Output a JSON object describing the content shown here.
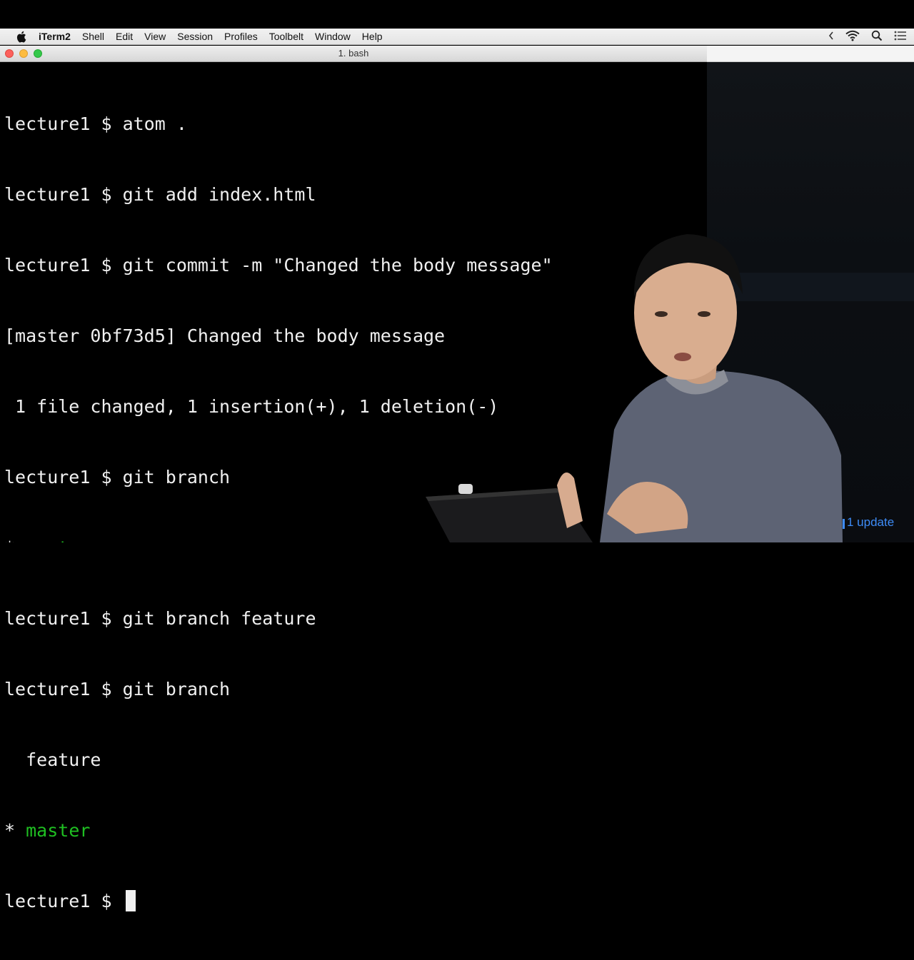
{
  "menubar": {
    "app": "iTerm2",
    "items": [
      "Shell",
      "Edit",
      "View",
      "Session",
      "Profiles",
      "Toolbelt",
      "Window",
      "Help"
    ]
  },
  "window": {
    "tab_title": "1. bash"
  },
  "terminal": {
    "lines": [
      {
        "prompt": "lecture1 $ ",
        "text": "atom ."
      },
      {
        "prompt": "lecture1 $ ",
        "text": "git add index.html"
      },
      {
        "prompt": "lecture1 $ ",
        "text": "git commit -m \"Changed the body message\""
      },
      {
        "prompt": "",
        "text": "[master 0bf73d5] Changed the body message"
      },
      {
        "prompt": "",
        "text": " 1 file changed, 1 insertion(+), 1 deletion(-)"
      },
      {
        "prompt": "lecture1 $ ",
        "text": "git branch"
      },
      {
        "marker": "* ",
        "branch": "master"
      },
      {
        "prompt": "lecture1 $ ",
        "text": "git branch feature"
      },
      {
        "prompt": "lecture1 $ ",
        "text": "git branch"
      },
      {
        "prompt": "",
        "text": "  feature"
      },
      {
        "marker": "* ",
        "branch": "master"
      },
      {
        "prompt": "lecture1 $ ",
        "text": ""
      }
    ],
    "colors": {
      "background": "#000000",
      "foreground": "#f0f0f0",
      "current_branch": "#1fbf22"
    }
  },
  "notification": {
    "label": "1 update",
    "color": "#3e8cf7"
  }
}
